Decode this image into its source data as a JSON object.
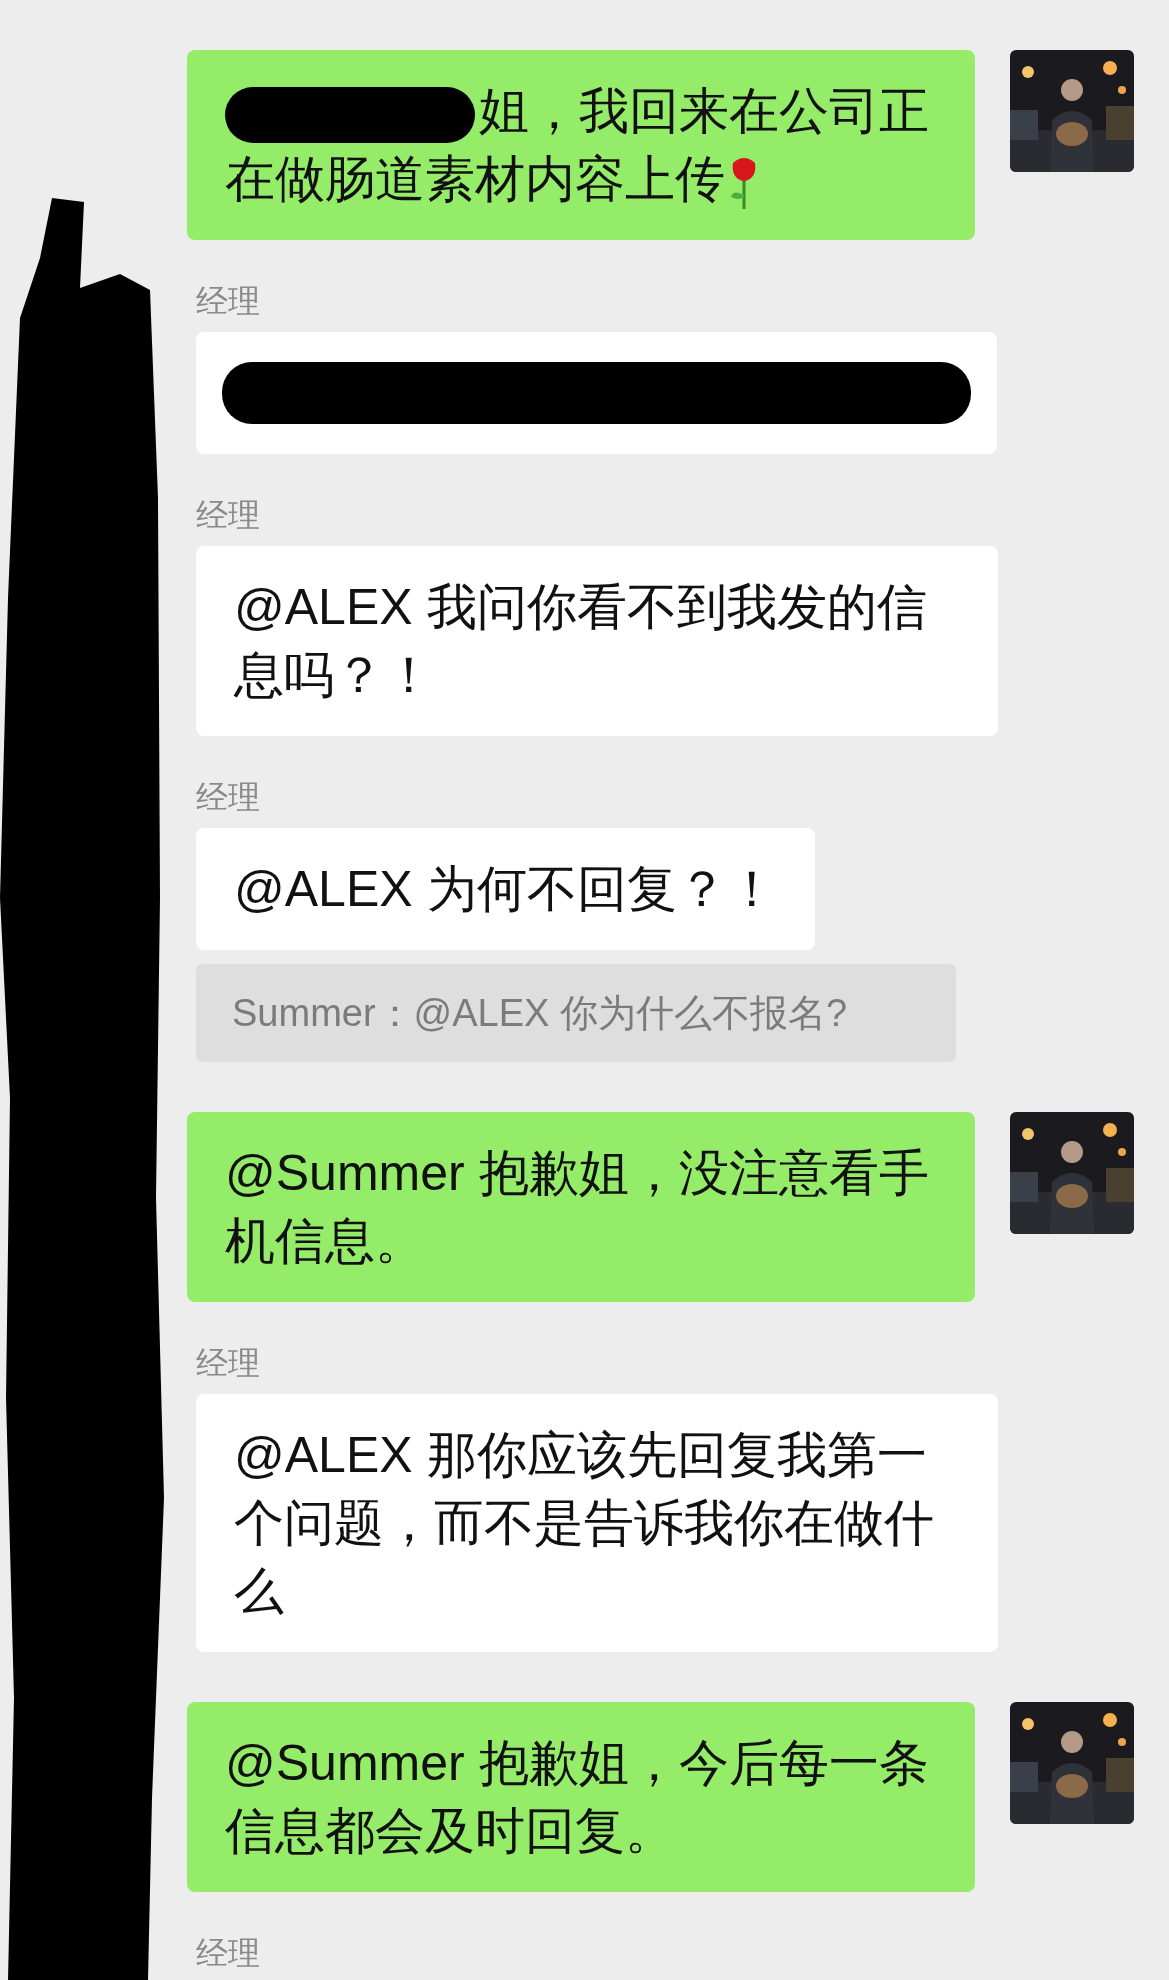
{
  "messages": [
    {
      "kind": "outgoing",
      "redacted_prefix": true,
      "text": "姐，我回来在公司正在做肠道素材内容上传",
      "end_icon": true
    },
    {
      "kind": "incoming",
      "sender": "经理",
      "redacted": true
    },
    {
      "kind": "incoming",
      "sender": "经理",
      "text": "@ALEX 我问你看不到我发的信息吗？！"
    },
    {
      "kind": "incoming",
      "sender": "经理",
      "text": "@ALEX 为何不回复？！"
    },
    {
      "kind": "quote",
      "text": "Summer：@ALEX 你为什么不报名?"
    },
    {
      "kind": "outgoing",
      "text": "@Summer 抱歉姐，没注意看手机信息。"
    },
    {
      "kind": "incoming",
      "sender": "经理",
      "text": "@ALEX 那你应该先回复我第一个问题，而不是告诉我你在做什么"
    },
    {
      "kind": "outgoing",
      "text": "@Summer 抱歉姐，今后每一条信息都会及时回复。"
    },
    {
      "kind": "sender_only",
      "sender": "经理"
    }
  ]
}
